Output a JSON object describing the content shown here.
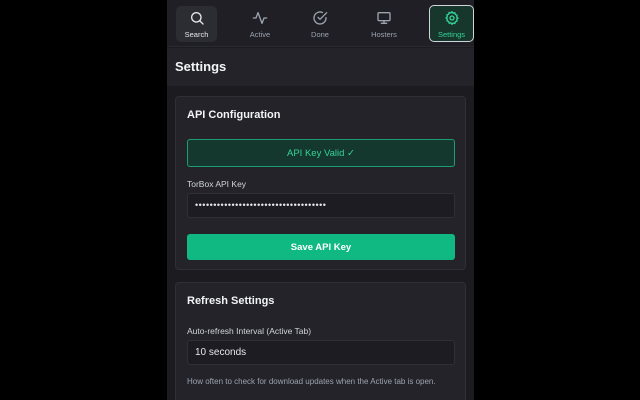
{
  "nav": {
    "items": [
      {
        "label": "Search",
        "icon": "search-icon"
      },
      {
        "label": "Active",
        "icon": "activity-icon"
      },
      {
        "label": "Done",
        "icon": "check-circle-icon"
      },
      {
        "label": "Hosters",
        "icon": "monitor-icon"
      },
      {
        "label": "Settings",
        "icon": "gear-icon"
      }
    ],
    "selected": "Settings"
  },
  "header": {
    "title": "Settings"
  },
  "api_config": {
    "title": "API Configuration",
    "status": "API Key Valid ✓",
    "key_label": "TorBox API Key",
    "key_value": "••••••••••••••••••••••••••••••••••••",
    "save_label": "Save API Key"
  },
  "refresh": {
    "title": "Refresh Settings",
    "interval_label": "Auto-refresh Interval (Active Tab)",
    "interval_value": "10 seconds",
    "help": "How often to check for download updates when the Active tab is open."
  },
  "colors": {
    "accent": "#10b981",
    "accent_text": "#34d399",
    "background": "#1b1b20",
    "card": "#232329"
  }
}
